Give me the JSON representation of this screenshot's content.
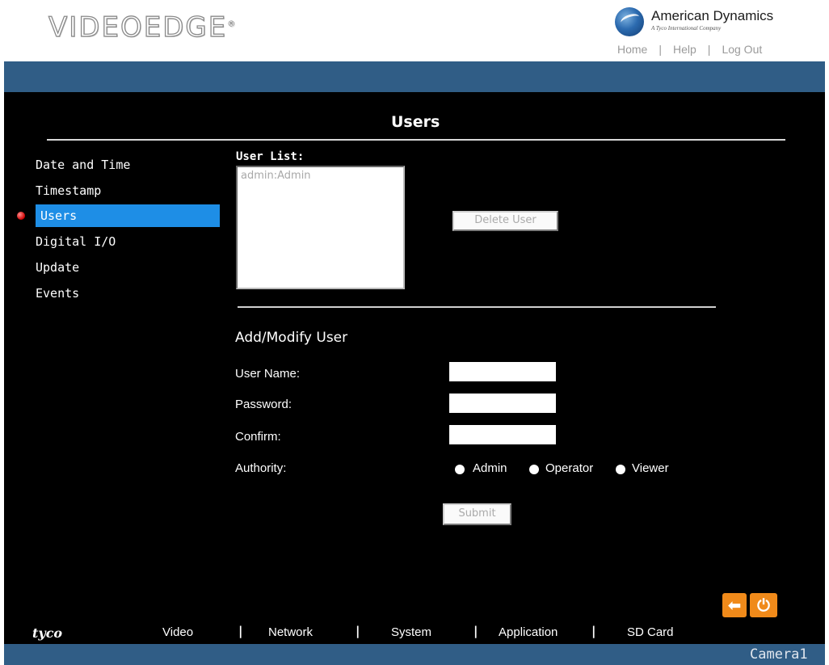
{
  "header": {
    "logo_text": "VIDEOEDGE",
    "logo_mark": "®",
    "brand_name": "American Dynamics",
    "brand_tagline": "A Tyco International Company",
    "links": [
      "Home",
      "Help",
      "Log Out"
    ],
    "link_separator": "|"
  },
  "page": {
    "title": "Users"
  },
  "sidebar": {
    "items": [
      {
        "label": "Date and Time"
      },
      {
        "label": "Timestamp"
      },
      {
        "label": "Users",
        "active": true
      },
      {
        "label": "Digital I/O"
      },
      {
        "label": "Update"
      },
      {
        "label": "Events"
      }
    ]
  },
  "user_list": {
    "label": "User List:",
    "items": [
      "admin:Admin"
    ],
    "delete_button": "Delete User"
  },
  "form": {
    "heading": "Add/Modify User",
    "username_label": "User Name:",
    "password_label": "Password:",
    "confirm_label": "Confirm:",
    "authority_label": "Authority:",
    "authority_options": [
      "Admin",
      "Operator",
      "Viewer"
    ],
    "submit_button": "Submit",
    "username_value": "",
    "password_value": "",
    "confirm_value": ""
  },
  "bottom_nav": {
    "brand": "tyco",
    "items": [
      "Video",
      "Network",
      "System",
      "Application",
      "SD Card"
    ],
    "separator": "|"
  },
  "controls": {
    "back_icon": "arrow-left-icon",
    "power_icon": "power-icon"
  },
  "footer": {
    "camera_name": "Camera1"
  },
  "colors": {
    "band": "#305d86",
    "active_item": "#1e8ee6",
    "panel": "#000000",
    "orange": "#f08a1a"
  }
}
